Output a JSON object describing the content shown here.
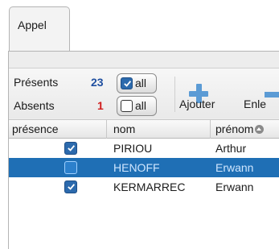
{
  "tabs": [
    {
      "label": "Appel"
    }
  ],
  "summary": {
    "present_label": "Présents",
    "present_count": "23",
    "absent_label": "Absents",
    "absent_count": "1",
    "all_present": {
      "label": "all",
      "checked": true
    },
    "all_absent": {
      "label": "all",
      "checked": false
    }
  },
  "toolbar": {
    "add_label": "Ajouter",
    "remove_label": "Enle",
    "add_icon": "plus-icon",
    "remove_icon": "minus-icon"
  },
  "table": {
    "columns": [
      "présence",
      "nom",
      "prénom"
    ],
    "sort_icon": "sort-ascending-icon",
    "rows": [
      {
        "presence": true,
        "nom": "PIRIOU",
        "prenom": "Arthur",
        "selected": false
      },
      {
        "presence": false,
        "nom": "HENOFF",
        "prenom": "Erwann",
        "selected": true
      },
      {
        "presence": true,
        "nom": "KERMARREC",
        "prenom": "Erwann",
        "selected": false
      }
    ]
  },
  "colors": {
    "accent": "#1f6fb5",
    "present_count": "#1f4fa0",
    "absent_count": "#d01c1c",
    "icon_blue": "#5b9bd5"
  }
}
